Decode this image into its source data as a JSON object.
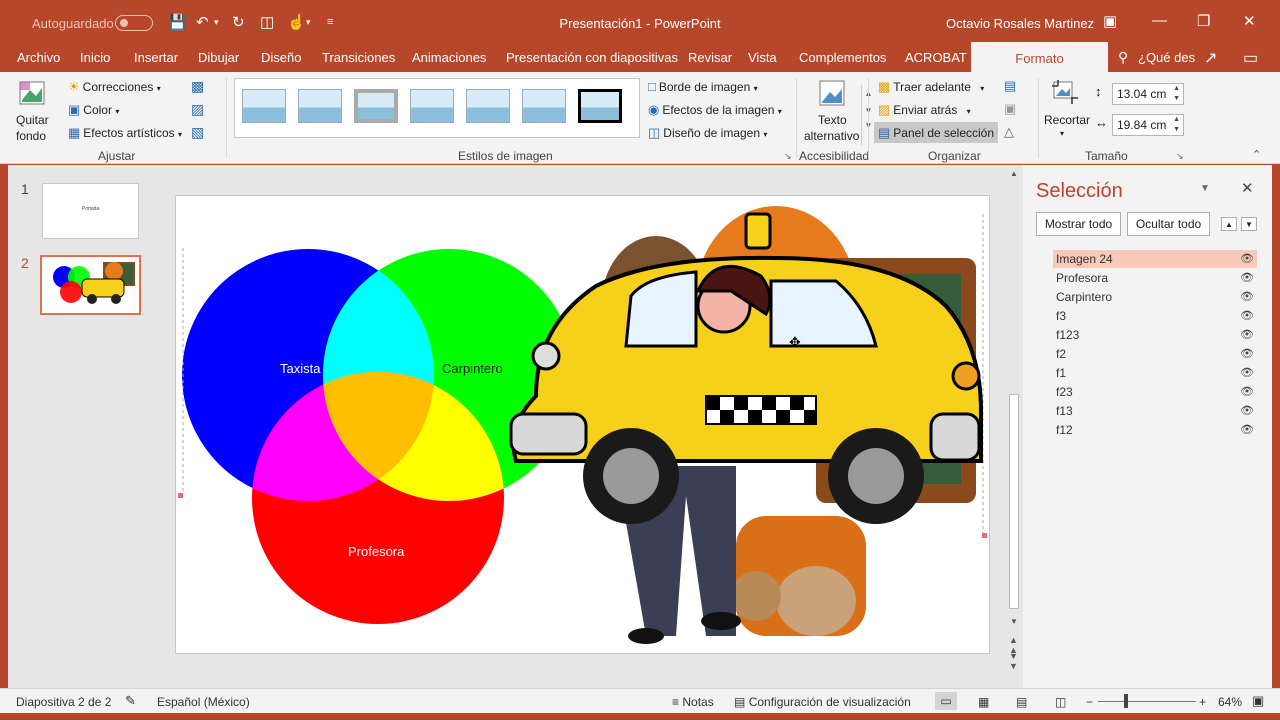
{
  "titlebar": {
    "autosave_label": "Autoguardado",
    "document_title": "Presentación1 - PowerPoint",
    "user_name": "Octavio Rosales Martinez"
  },
  "tabs": [
    {
      "label": "Archivo"
    },
    {
      "label": "Inicio"
    },
    {
      "label": "Insertar"
    },
    {
      "label": "Dibujar"
    },
    {
      "label": "Diseño"
    },
    {
      "label": "Transiciones"
    },
    {
      "label": "Animaciones"
    },
    {
      "label": "Presentación con diapositivas"
    },
    {
      "label": "Revisar"
    },
    {
      "label": "Vista"
    },
    {
      "label": "Complementos"
    },
    {
      "label": "ACROBAT"
    },
    {
      "label": "Formato"
    }
  ],
  "search": {
    "text": "¿Qué des"
  },
  "ribbon": {
    "adjust": {
      "remove_bg": "Quitar",
      "remove_bg2": "fondo",
      "corrections": "Correcciones",
      "color": "Color",
      "artistic": "Efectos artísticos",
      "group": "Ajustar"
    },
    "styles": {
      "border": "Borde de imagen",
      "effects": "Efectos de la imagen",
      "layout": "Diseño de imagen",
      "group": "Estilos de imagen"
    },
    "accessibility": {
      "alt_text1": "Texto",
      "alt_text2": "alternativo",
      "group": "Accesibilidad"
    },
    "arrange": {
      "bring_forward": "Traer adelante",
      "send_backward": "Enviar atrás",
      "selection_pane": "Panel de selección",
      "group": "Organizar"
    },
    "size": {
      "crop": "Recortar",
      "height": "13.04 cm",
      "width": "19.84 cm",
      "group": "Tamaño"
    }
  },
  "slides": [
    {
      "number": "1",
      "thumb_text": "Portada"
    },
    {
      "number": "2"
    }
  ],
  "venn": {
    "labels": {
      "taxista": "Taxista",
      "carpintero": "Carpintero",
      "profesora": "Profesora"
    },
    "colors": {
      "blue": "#0000ff",
      "green": "#00ff00",
      "red": "#ff0000",
      "cyan": "#00ffff",
      "magenta": "#ff00ff",
      "yellow": "#ffff00",
      "center": "#ffbf00"
    }
  },
  "selection_pane": {
    "title": "Selección",
    "show_all": "Mostrar todo",
    "hide_all": "Ocultar todo",
    "items": [
      "Imagen 24",
      "Profesora",
      "Carpintero",
      "f3",
      "f123",
      "f2",
      "f1",
      "f23",
      "f13",
      "f12"
    ]
  },
  "status": {
    "slide_info": "Diapositiva 2 de 2",
    "language": "Español (México)",
    "notes": "Notas",
    "display_settings": "Configuración de visualización",
    "zoom": "64%"
  },
  "accent_color": "#b7472a"
}
